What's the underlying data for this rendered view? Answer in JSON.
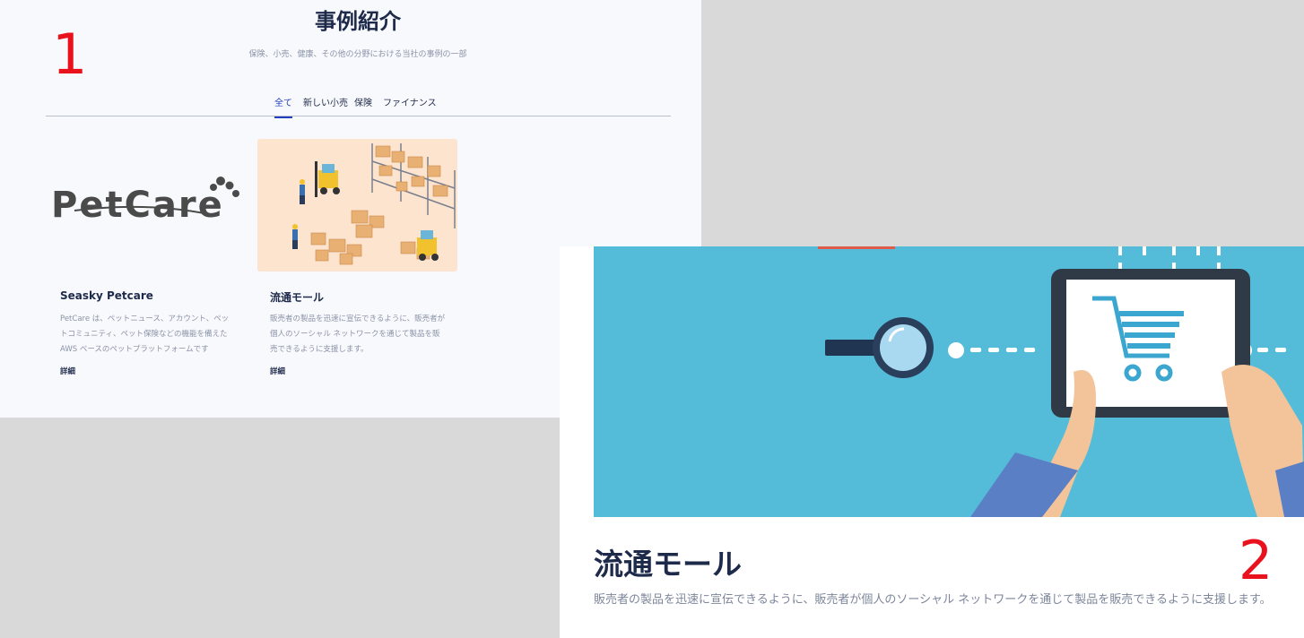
{
  "markers": {
    "one": "1",
    "two": "2"
  },
  "section": {
    "title": "事例紹介",
    "subtitle": "保険、小売、健康、その他の分野における当社の事例の一部"
  },
  "tabs": [
    {
      "label": "全て",
      "active": true
    },
    {
      "label": "新しい小売",
      "active": false
    },
    {
      "label": "保険",
      "active": false
    },
    {
      "label": "ファイナンス",
      "active": false
    }
  ],
  "cards": [
    {
      "logo_text": "PetCare",
      "title": "Seasky Petcare",
      "description": "PetCare は、ペットニュース、アカウント、ペットコミュニティ、ペット保険などの機能を備えた AWS ベースのペットプラットフォームです",
      "link": "詳細"
    },
    {
      "image": "warehouse-illustration",
      "title": "流通モール",
      "description": "販売者の製品を迅速に宣伝できるように、販売者が個人のソーシャル ネットワークを通じて製品を販売できるように支援します。",
      "link": "詳細"
    }
  ],
  "detail": {
    "image": "tablet-shopping-cart-illustration",
    "title": "流通モール",
    "description": "販売者の製品を迅速に宣伝できるように、販売者が個人のソーシャル ネットワークを通じて製品を販売できるように支援します。"
  },
  "colors": {
    "accent": "#1f3fbf",
    "marker": "#e8111c",
    "hero_bg": "#54bcd9",
    "warehouse_bg": "#fde4cf",
    "text_dark": "#1e2a4a",
    "text_muted": "#8a93a8"
  }
}
